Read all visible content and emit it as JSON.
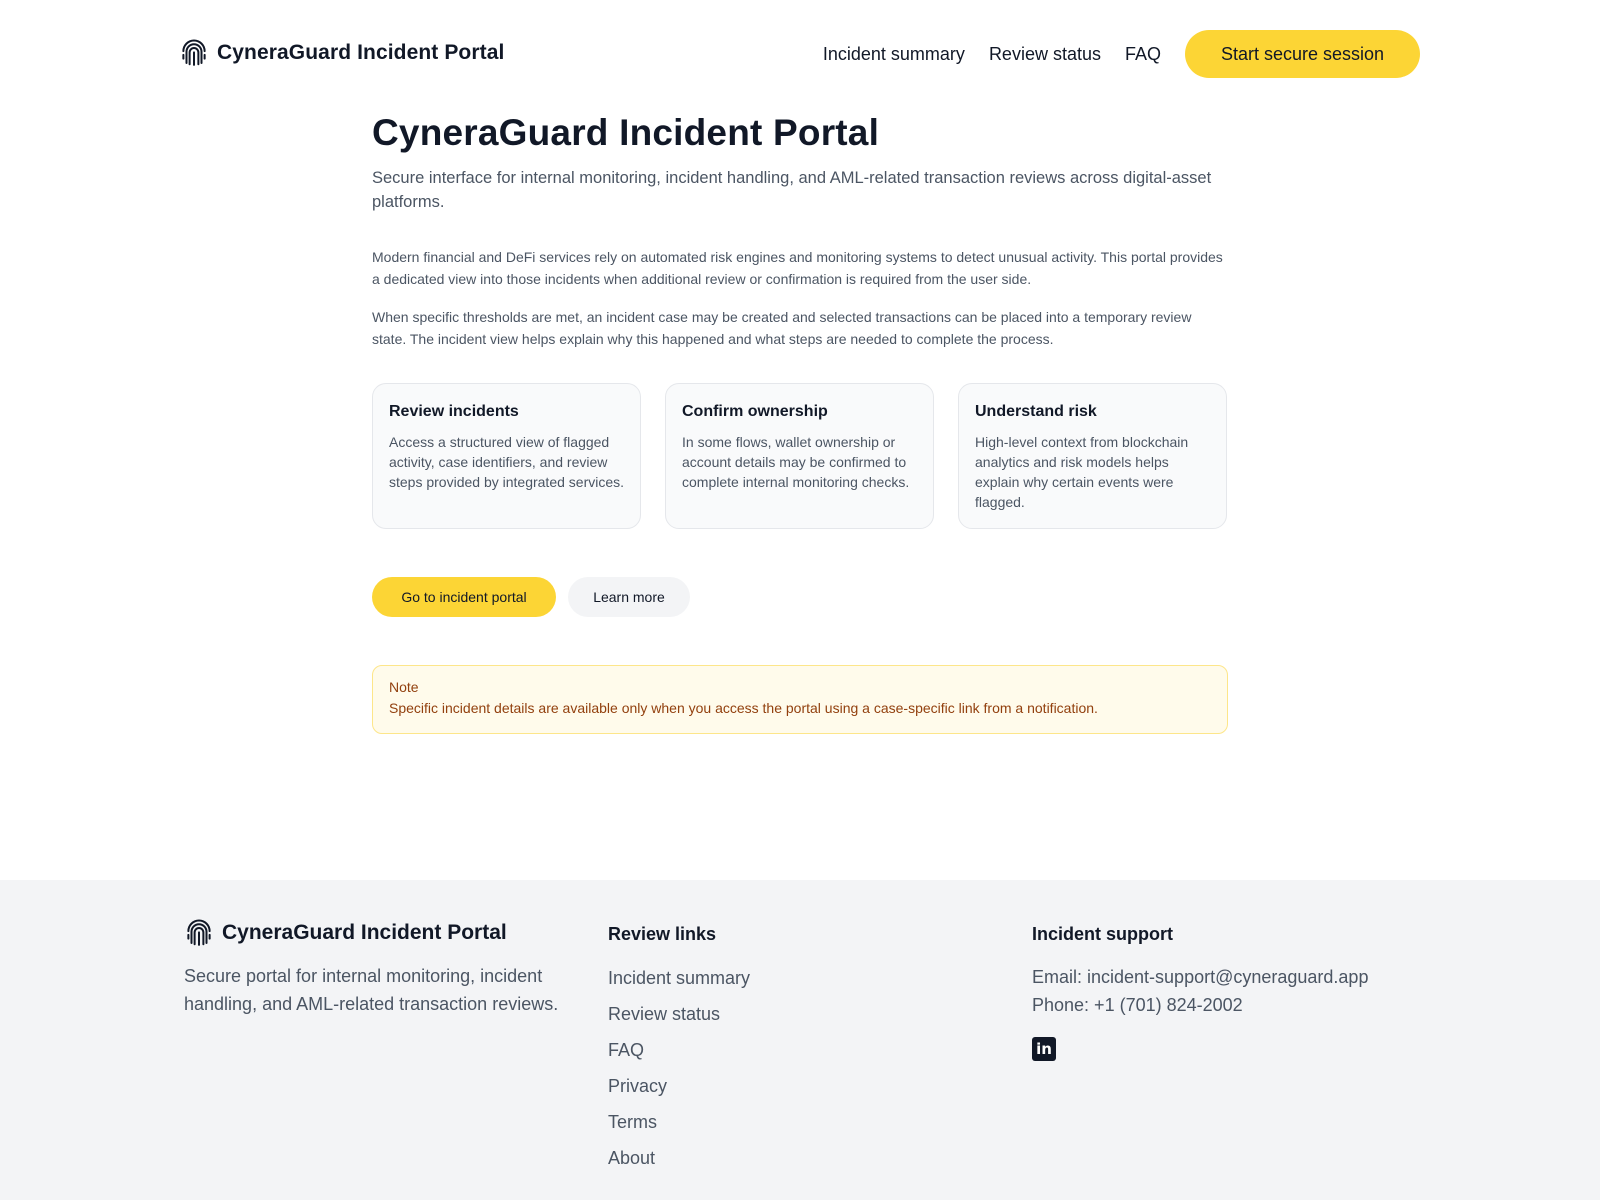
{
  "header": {
    "brand": "CyneraGuard Incident Portal",
    "nav": [
      "Incident summary",
      "Review status",
      "FAQ"
    ],
    "cta": "Start secure session"
  },
  "main": {
    "title": "CyneraGuard Incident Portal",
    "subtitle": "Secure interface for internal monitoring, incident handling, and AML-related transaction reviews across digital-asset platforms.",
    "paragraphs": [
      "Modern financial and DeFi services rely on automated risk engines and monitoring systems to detect unusual activity. This portal provides a dedicated view into those incidents when additional review or confirmation is required from the user side.",
      "When specific thresholds are met, an incident case may be created and selected transactions can be placed into a temporary review state. The incident view helps explain why this happened and what steps are needed to complete the process."
    ],
    "cards": [
      {
        "title": "Review incidents",
        "description": "Access a structured view of flagged activity, case identifiers, and review steps provided by integrated services."
      },
      {
        "title": "Confirm ownership",
        "description": "In some flows, wallet ownership or account details may be confirmed to complete internal monitoring checks."
      },
      {
        "title": "Understand risk",
        "description": "High-level context from blockchain analytics and risk models helps explain why certain events were flagged."
      }
    ],
    "primary_button": "Go to incident portal",
    "secondary_button": "Learn more",
    "note": {
      "title": "Note",
      "text": "Specific incident details are available only when you access the portal using a case-specific link from a notification."
    }
  },
  "footer": {
    "brand": "CyneraGuard Incident Portal",
    "description": "Secure portal for internal monitoring, incident handling, and AML-related transaction reviews.",
    "links_heading": "Review links",
    "links": [
      "Incident summary",
      "Review status",
      "FAQ",
      "Privacy",
      "Terms",
      "About"
    ],
    "support_heading": "Incident support",
    "email": "Email: incident-support@cyneraguard.app",
    "phone": "Phone: +1 (701) 824-2002",
    "social_icon": "linkedin-icon"
  },
  "colors": {
    "accent": "#fcd535",
    "note_bg": "#fffbeb",
    "note_text": "#92400e",
    "footer_bg": "#f3f4f6"
  }
}
